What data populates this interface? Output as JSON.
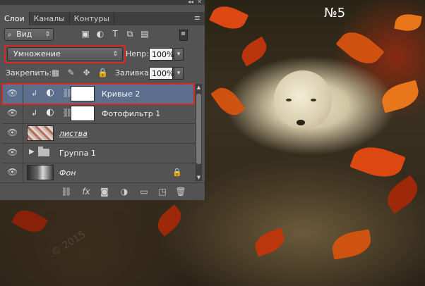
{
  "photo": {
    "label": "№5",
    "leaf_colors": [
      "#e64a12",
      "#c2360c",
      "#f07a1a",
      "#a3280a",
      "#d6530f",
      "#8e2208"
    ]
  },
  "panel": {
    "tabs": [
      {
        "label": "Слои",
        "active": true
      },
      {
        "label": "Каналы",
        "active": false
      },
      {
        "label": "Контуры",
        "active": false
      }
    ],
    "menu_icon": "panel-menu-icon",
    "filter": {
      "kind_label": "Вид",
      "icons": [
        "image-filter-icon",
        "adjustment-filter-icon",
        "type-filter-icon",
        "shape-filter-icon",
        "smartobject-filter-icon"
      ]
    },
    "blend_mode": "Умножение",
    "opacity_label": "Непр:",
    "opacity_value": "100%",
    "lock_label": "Закрепить:",
    "lock_icons": [
      "lock-transparent-icon",
      "lock-image-icon",
      "lock-position-icon",
      "lock-all-icon"
    ],
    "fill_label": "Заливка:",
    "fill_value": "100%",
    "layers": [
      {
        "name": "Кривые 2",
        "type": "adjustment",
        "selected": true,
        "clipped": true
      },
      {
        "name": "Фотофильтр 1",
        "type": "adjustment",
        "selected": false,
        "clipped": true
      },
      {
        "name": "листва",
        "type": "pixel",
        "selected": false
      },
      {
        "name": "Группа 1",
        "type": "group",
        "selected": false
      },
      {
        "name": "Фон",
        "type": "background",
        "selected": false,
        "locked": true
      }
    ],
    "footer_icons": [
      "link-layers-icon",
      "fx-icon",
      "add-mask-icon",
      "new-adjustment-icon",
      "new-group-icon",
      "new-layer-icon",
      "trash-icon"
    ],
    "highlight_color": "#d42a22",
    "selected_row_color": "#5b6f8d"
  }
}
